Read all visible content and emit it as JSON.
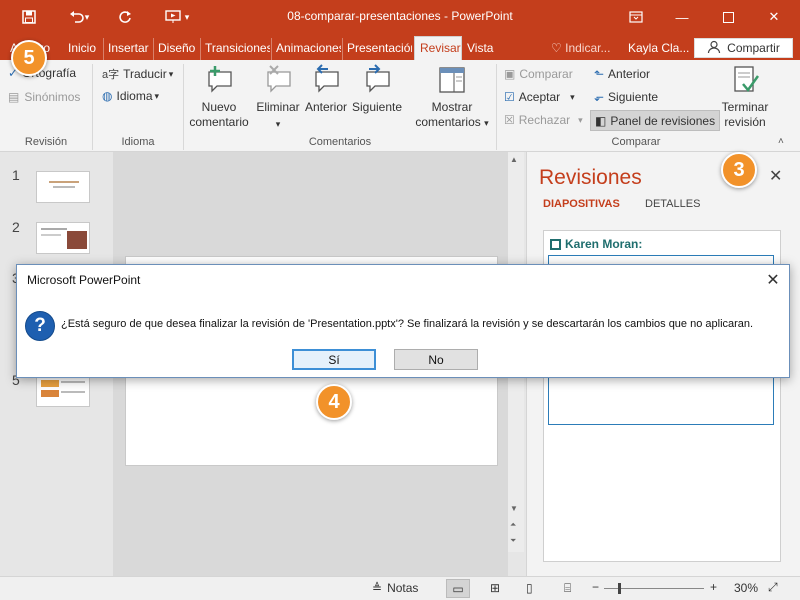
{
  "window": {
    "title": "08-comparar-presentaciones  -  PowerPoint",
    "user": "Kayla Cla...",
    "tell_me": "Indicar...",
    "share": "Compartir"
  },
  "tabs": [
    {
      "label": "Archivo"
    },
    {
      "label": "Inicio"
    },
    {
      "label": "Insertar"
    },
    {
      "label": "Diseño"
    },
    {
      "label": "Transiciones"
    },
    {
      "label": "Animaciones"
    },
    {
      "label": "Presentación"
    },
    {
      "label": "Revisar",
      "active": true
    },
    {
      "label": "Vista"
    }
  ],
  "ribbon": {
    "revision": {
      "label": "Revisión",
      "spelling": "Ortografía",
      "thesaurus": "Sinónimos"
    },
    "language": {
      "label": "Idioma",
      "translate": "Traducir",
      "language": "Idioma"
    },
    "comments": {
      "label": "Comentarios",
      "new": "Nuevo comentario",
      "delete": "Eliminar",
      "previous": "Anterior",
      "next": "Siguiente",
      "show": "Mostrar comentarios"
    },
    "compare": {
      "label": "Comparar",
      "compare": "Comparar",
      "accept": "Aceptar",
      "reject": "Rechazar",
      "previous": "Anterior",
      "next": "Siguiente",
      "pane": "Panel de revisiones",
      "end_review": "Terminar revisión"
    }
  },
  "thumbnails": [
    {
      "number": "1"
    },
    {
      "number": "2"
    },
    {
      "number": "3"
    },
    {
      "number": "5"
    }
  ],
  "pane": {
    "title": "Revisiones",
    "tab_slides": "DIAPOSITIVAS",
    "tab_details": "DETALLES",
    "reviewer": "Karen Moran:"
  },
  "status": {
    "notes": "Notas",
    "zoom": "30%"
  },
  "dialog": {
    "title": "Microsoft PowerPoint",
    "message": "¿Está seguro de que desea finalizar la revisión de 'Presentation.pptx'? Se finalizará la revisión  y se descartarán los cambios que no aplicaran.",
    "yes": "Sí",
    "no": "No"
  },
  "badges": {
    "three": "3",
    "four": "4",
    "five": "5"
  },
  "colors": {
    "accent": "#c43e1c",
    "badge": "#f2922a",
    "dialog_icon": "#1e5fb0"
  }
}
